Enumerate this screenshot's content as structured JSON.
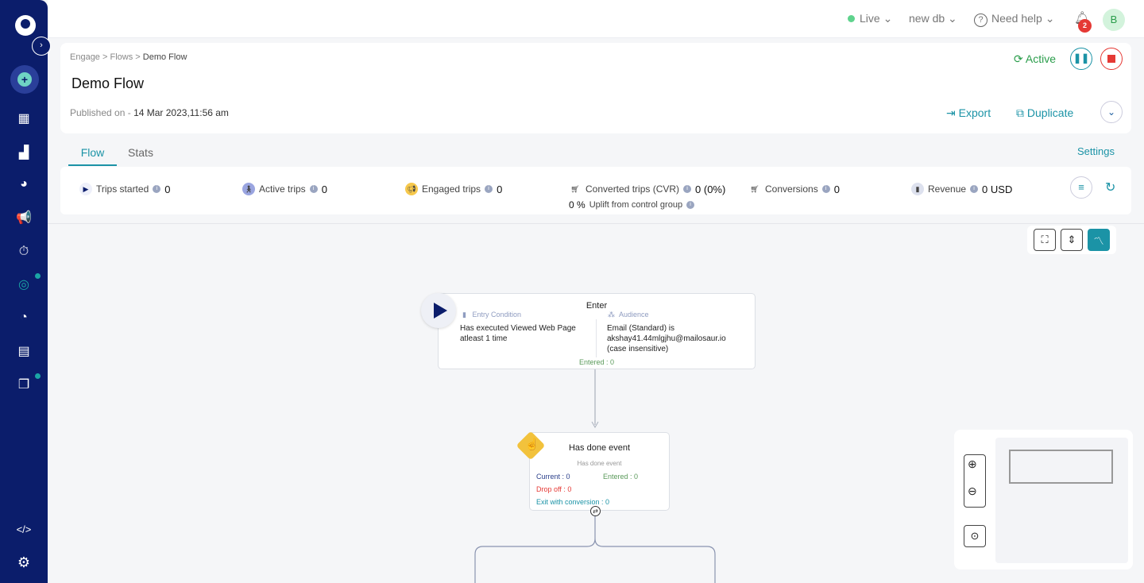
{
  "topbar": {
    "env": "Live",
    "db": "new db",
    "help": "Need help",
    "notifications": "2",
    "avatar": "B"
  },
  "header": {
    "breadcrumb": [
      "Engage",
      "Flows",
      "Demo Flow"
    ],
    "title": "Demo Flow",
    "published_label": "Published on - ",
    "published_date": "14 Mar 2023,11:56 am",
    "status": "Active",
    "export": "Export",
    "duplicate": "Duplicate"
  },
  "tabs": [
    "Flow",
    "Stats"
  ],
  "active_tab": "Flow",
  "settings": "Settings",
  "metrics": [
    {
      "label": "Trips started",
      "value": "0",
      "icon": "play-icon"
    },
    {
      "label": "Active trips",
      "value": "0",
      "icon": "walking-icon"
    },
    {
      "label": "Engaged trips",
      "value": "0",
      "icon": "megaphone-icon"
    },
    {
      "label": "Converted trips (CVR)",
      "value": "0 (0%)",
      "icon": "cart-icon"
    },
    {
      "label": "Conversions",
      "value": "0",
      "icon": "cart-icon"
    },
    {
      "label": "Revenue",
      "value": "0 USD",
      "icon": "bar-chart-icon"
    }
  ],
  "uplift": {
    "value": "0 %",
    "label": "Uplift from control group"
  },
  "entry_node": {
    "title": "Enter",
    "entry_label": "Entry Condition",
    "entry_text": "Has executed Viewed Web Page atleast 1 time",
    "audience_label": "Audience",
    "audience_text": "Email (Standard)  is akshay41.44mlgjhu@mailosaur.io (case insensitive)",
    "entered": "Entered : 0"
  },
  "event_node": {
    "title": "Has done event",
    "subtitle": "Has done event",
    "current": "Current : 0",
    "entered": "Entered : 0",
    "dropoff": "Drop off : 0",
    "exit": "Exit with conversion : 0"
  },
  "colors": {
    "sidebar": "#0b1d6b",
    "accent": "#1b93a6",
    "active": "#2a9d4b",
    "stop": "#e53935"
  }
}
